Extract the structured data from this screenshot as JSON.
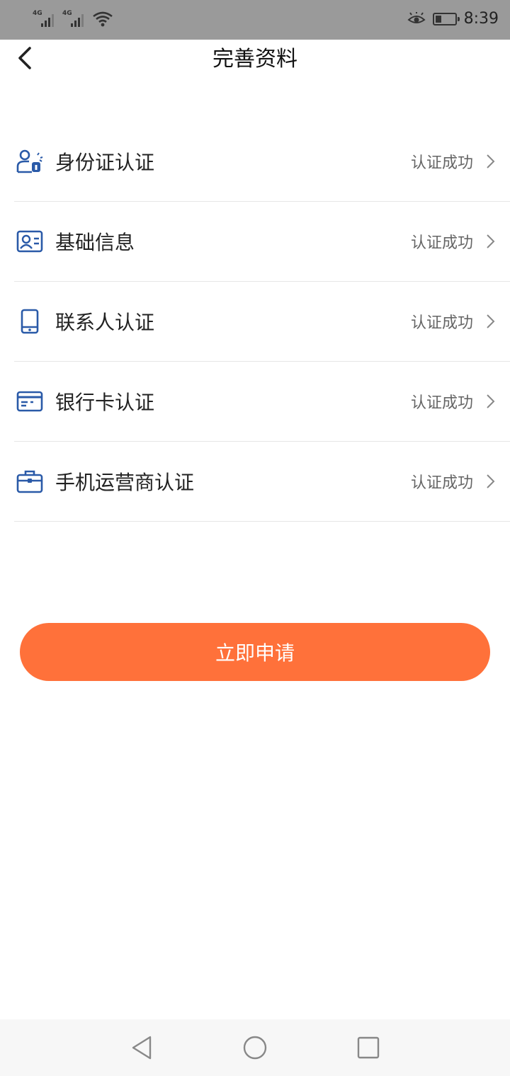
{
  "status_bar": {
    "network_1": "4G",
    "network_2": "4G",
    "time": "8:39",
    "icons": [
      "signal-icon",
      "signal-icon",
      "wifi-icon",
      "eye-icon",
      "battery-icon"
    ]
  },
  "header": {
    "title": "完善资料",
    "back_icon": "chevron-left-icon"
  },
  "list": {
    "items": [
      {
        "label": "身份证认证",
        "status": "认证成功",
        "icon": "id-person-icon"
      },
      {
        "label": "基础信息",
        "status": "认证成功",
        "icon": "id-card-icon"
      },
      {
        "label": "联系人认证",
        "status": "认证成功",
        "icon": "phone-icon"
      },
      {
        "label": "银行卡认证",
        "status": "认证成功",
        "icon": "bank-card-icon"
      },
      {
        "label": "手机运营商认证",
        "status": "认证成功",
        "icon": "briefcase-icon"
      }
    ]
  },
  "apply_button": {
    "label": "立即申请"
  },
  "colors": {
    "accent": "#ff713a",
    "icon_blue": "#2a5aa8",
    "status_bar": "#9a9a9a"
  },
  "nav_bar": {
    "icons": [
      "back-triangle-icon",
      "home-circle-icon",
      "recents-square-icon"
    ]
  }
}
